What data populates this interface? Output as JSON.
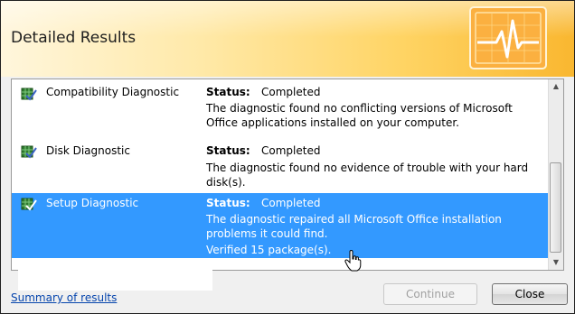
{
  "window": {
    "title": "Detailed Results"
  },
  "results": [
    {
      "name": "Compatibility Diagnostic",
      "status_label": "Status:",
      "status": "Completed",
      "description": "The diagnostic found no conflicting versions of Microsoft Office applications installed on your computer.",
      "extra": "",
      "selected": false
    },
    {
      "name": "Disk Diagnostic",
      "status_label": "Status:",
      "status": "Completed",
      "description": "The diagnostic found no evidence of trouble with your hard disk(s).",
      "extra": "",
      "selected": false
    },
    {
      "name": "Setup Diagnostic",
      "status_label": "Status:",
      "status": "Completed",
      "description": "The diagnostic repaired all Microsoft Office installation problems it could find.",
      "extra": "Verified 15 package(s).",
      "selected": true
    }
  ],
  "footer": {
    "summary_link": "Summary of results",
    "continue_label": "Continue",
    "close_label": "Close"
  },
  "colors": {
    "selection": "#3399ff",
    "header_gradient_end": "#f9b730",
    "link": "#0645ad"
  },
  "icons": {
    "header": "heartbeat-monitor-icon",
    "row": "diagnostic-check-icon"
  }
}
